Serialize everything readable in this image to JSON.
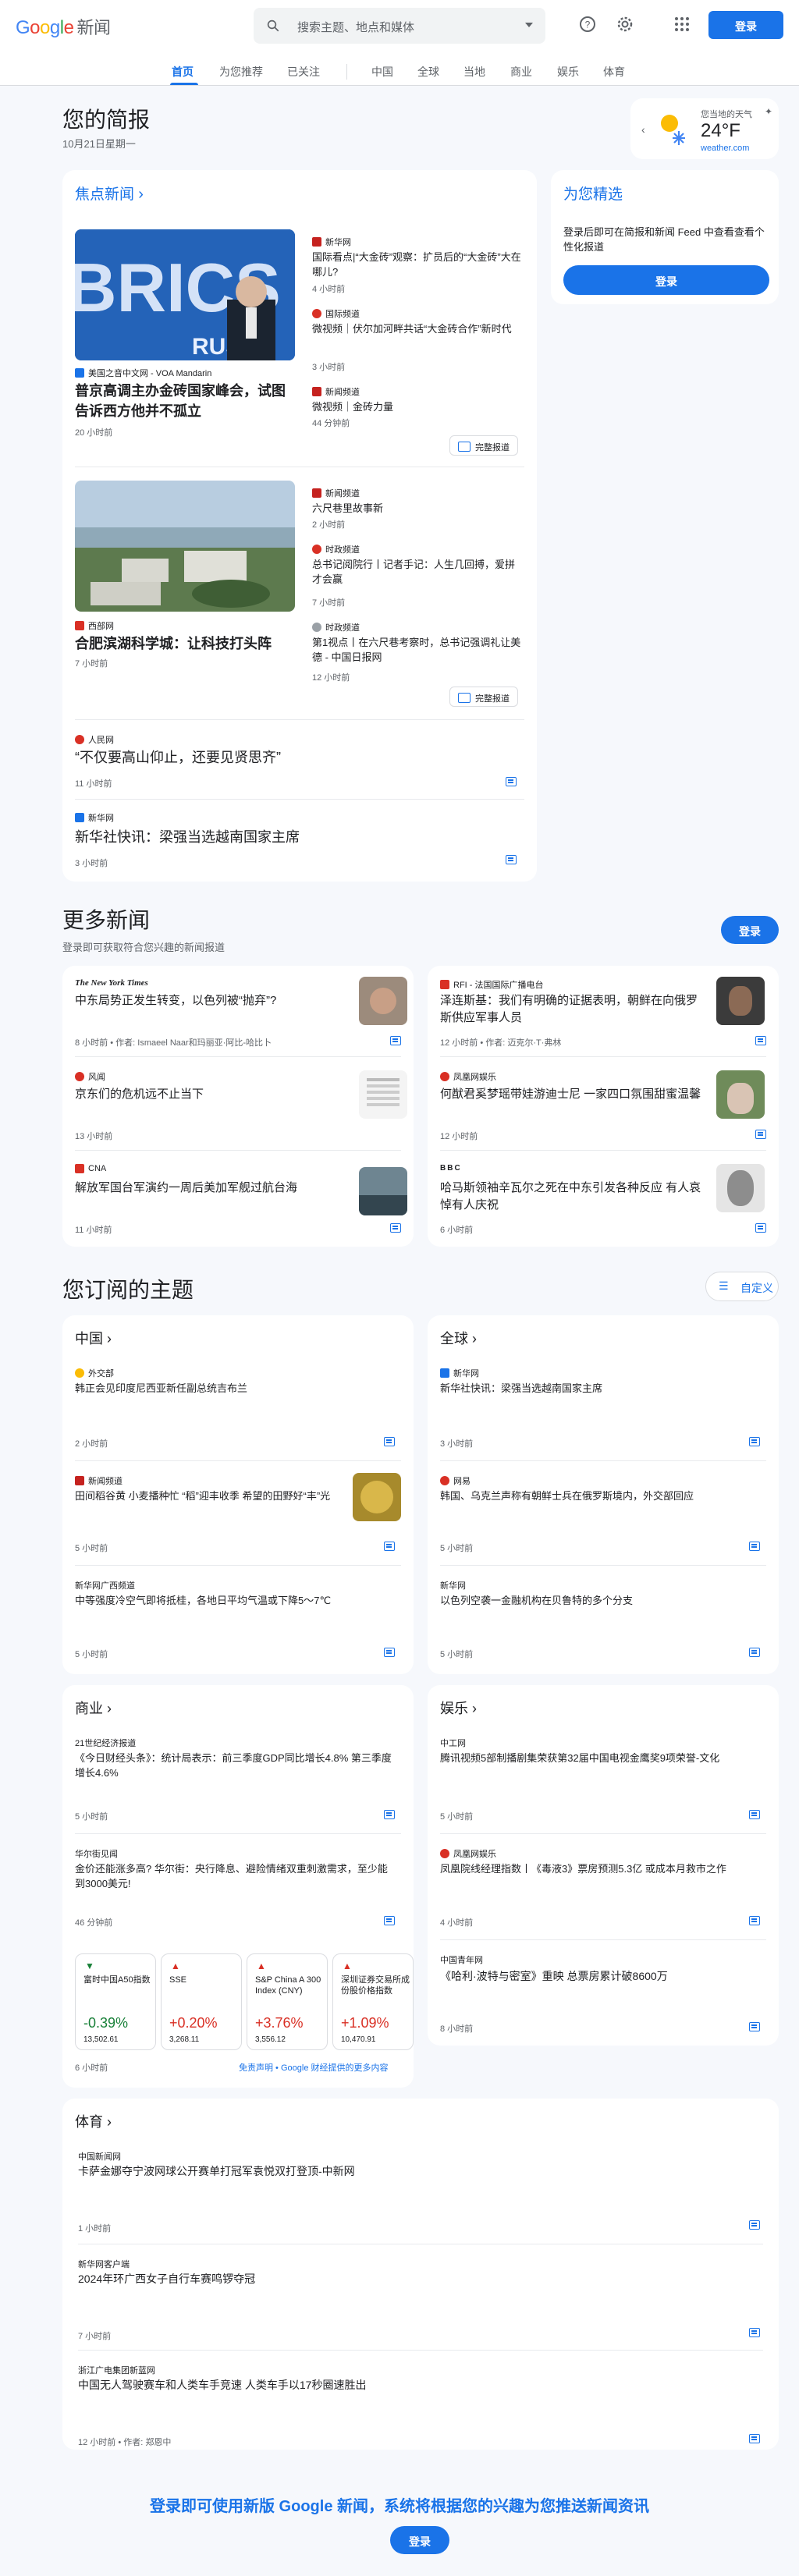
{
  "header": {
    "logo_google": "Google",
    "logo_news": "新闻",
    "search_placeholder": "搜索主题、地点和媒体",
    "signin": "登录"
  },
  "nav": [
    "首页",
    "为您推荐",
    "已关注",
    "中国",
    "全球",
    "当地",
    "商业",
    "娱乐",
    "体育"
  ],
  "briefing": {
    "title": "您的简报",
    "date": "10月21日星期一"
  },
  "weather": {
    "label": "您当地的天气",
    "temp": "24°F",
    "source": "weather.com"
  },
  "top_stories": {
    "title": "焦点新闻",
    "stories": [
      {
        "main_source": "美国之音中文网 - VOA Mandarin",
        "main_headline": "普京高调主办金砖国家峰会，试图告诉西方他并不孤立",
        "main_time": "20 小时前",
        "related": [
          {
            "source": "新华网",
            "headline": "国际看点|“大金砖”观察：扩员后的“大金砖”大在哪儿?",
            "time": "4 小时前"
          },
          {
            "source": "国际频道",
            "headline": "微视频｜伏尔加河畔共话“大金砖合作”新时代",
            "time": "3 小时前"
          },
          {
            "source": "新闻频道",
            "headline": "微视频｜金砖力量",
            "time": "44 分钟前"
          }
        ],
        "full_coverage": "完整报道"
      },
      {
        "main_source": "西部网",
        "main_headline": "合肥滨湖科学城：让科技打头阵",
        "main_time": "7 小时前",
        "related": [
          {
            "source": "新闻频道",
            "headline": "六尺巷里故事新",
            "time": "2 小时前"
          },
          {
            "source": "时政频道",
            "headline": "总书记阅院行丨记者手记：人生几回搏，爱拼才会赢",
            "time": "7 小时前"
          },
          {
            "source": "时政频道",
            "headline": "第1视点丨在六尺巷考察时，总书记强调礼让美德 - 中国日报网",
            "time": "12 小时前"
          }
        ],
        "full_coverage": "完整报道"
      }
    ],
    "singles": [
      {
        "source": "人民网",
        "headline": "“不仅要高山仰止，还要见贤思齐”",
        "time": "11 小时前"
      },
      {
        "source": "新华网",
        "headline": "新华社快讯：梁强当选越南国家主席",
        "time": "3 小时前"
      }
    ]
  },
  "picks": {
    "title": "为您精选",
    "desc": "登录后即可在简报和新闻 Feed 中查看查看个性化报道",
    "button": "登录"
  },
  "more_news": {
    "title": "更多新闻",
    "sub": "登录即可获取符合您兴趣的新闻报道",
    "button": "登录",
    "items": [
      {
        "source": "The New York Times",
        "headline": "中东局势正发生转变，以色列被“抛弃”?",
        "time": "8 小时前",
        "author": "作者: Ismaeel Naar和玛丽亚·阿比-哈比卜"
      },
      {
        "source": "RFI - 法国国际广播电台",
        "headline": "泽连斯基：我们有明确的证据表明，朝鲜在向俄罗斯供应军事人员",
        "time": "12 小时前",
        "author": "作者: 迈克尔·T·弗林"
      },
      {
        "source": "风闻",
        "headline": "京东们的危机远不止当下",
        "time": "13 小时前",
        "author": ""
      },
      {
        "source": "凤凰网娱乐",
        "headline": "何猷君奚梦瑶带娃游迪士尼 一家四口氛围甜蜜温馨",
        "time": "12 小时前",
        "author": ""
      },
      {
        "source": "CNA",
        "headline": "解放军国台军演约一周后美加军舰过航台海",
        "time": "11 小时前",
        "author": ""
      },
      {
        "source": "BBC",
        "headline": "哈马斯领袖辛瓦尔之死在中东引发各种反应 有人哀悼有人庆祝",
        "time": "6 小时前",
        "author": ""
      }
    ]
  },
  "topics": {
    "title": "您订阅的主题",
    "customize": "自定义",
    "china": {
      "title": "中国",
      "items": [
        {
          "source": "外交部",
          "headline": "韩正会见印度尼西亚新任副总统吉布兰",
          "time": "2 小时前"
        },
        {
          "source": "新闻频道",
          "headline": "田间稻谷黄 小麦播种忙 “稻”迎丰收季 希望的田野好“丰”光",
          "time": "5 小时前"
        },
        {
          "source": "新华网广西频道",
          "headline": "中等强度冷空气即将抵桂，各地日平均气温或下降5～7℃",
          "time": "5 小时前"
        }
      ]
    },
    "world": {
      "title": "全球",
      "items": [
        {
          "source": "新华网",
          "headline": "新华社快讯：梁强当选越南国家主席",
          "time": "3 小时前"
        },
        {
          "source": "网易",
          "headline": "韩国、乌克兰声称有朝鲜士兵在俄罗斯境内，外交部回应",
          "time": "5 小时前"
        },
        {
          "source": "新华网",
          "headline": "以色列空袭一金融机构在贝鲁特的多个分支",
          "time": "5 小时前"
        }
      ]
    },
    "business": {
      "title": "商业",
      "items": [
        {
          "source": "21世纪经济报道",
          "headline": "《今日财经头条》：统计局表示：前三季度GDP同比增长4.8% 第三季度增长4.6%",
          "time": "5 小时前"
        },
        {
          "source": "华尔街见闻",
          "headline": "金价还能涨多高? 华尔街：央行降息、避险情绪双重刺激需求，至少能到3000美元!",
          "time": "46 分钟前"
        }
      ],
      "indices": [
        {
          "name": "富时中国A50指数",
          "pct": "-0.39%",
          "value": "13,502.61",
          "dir": "down"
        },
        {
          "name": "SSE",
          "pct": "+0.20%",
          "value": "3,268.11",
          "dir": "up"
        },
        {
          "name": "S&P China A 300 Index (CNY)",
          "pct": "+3.76%",
          "value": "3,556.12",
          "dir": "up"
        },
        {
          "name": "深圳证券交易所成份股价格指数",
          "pct": "+1.09%",
          "value": "10,470.91",
          "dir": "up"
        }
      ],
      "index_time": "6 小时前",
      "disclaimer": "免责声明 • Google 财经提供的更多内容"
    },
    "entertainment": {
      "title": "娱乐",
      "items": [
        {
          "source": "中工网",
          "headline": "腾讯视频5部制播剧集荣获第32届中国电视金鹰奖9项荣誉-文化",
          "time": "5 小时前"
        },
        {
          "source": "凤凰网娱乐",
          "headline": "凤凰院线经理指数丨《毒液3》票房预测5.3亿 或成本月救市之作",
          "time": "4 小时前"
        },
        {
          "source": "中国青年网",
          "headline": "《哈利·波特与密室》重映 总票房累计破8600万",
          "time": "8 小时前"
        }
      ]
    },
    "sports": {
      "title": "体育",
      "items": [
        {
          "source": "中国新闻网",
          "headline": "卡萨金娜夺宁波网球公开赛单打冠军袁悦双打登顶-中新网",
          "time": "1 小时前",
          "author": ""
        },
        {
          "source": "新华网客户端",
          "headline": "2024年环广西女子自行车赛鸣锣夺冠",
          "time": "7 小时前",
          "author": ""
        },
        {
          "source": "浙江广电集团新蓝网",
          "headline": "中国无人驾驶赛车和人类车手竞速 人类车手以17秒圈速胜出",
          "time": "12 小时前",
          "author": "作者: 郑恩中"
        }
      ]
    }
  },
  "footer": {
    "cta": "登录即可使用新版 Google 新闻，系统将根据您的兴趣为您推送新闻资讯",
    "button": "登录"
  },
  "colors": {
    "accent": "#1a73e8",
    "up": "#d93025",
    "down": "#188038"
  }
}
